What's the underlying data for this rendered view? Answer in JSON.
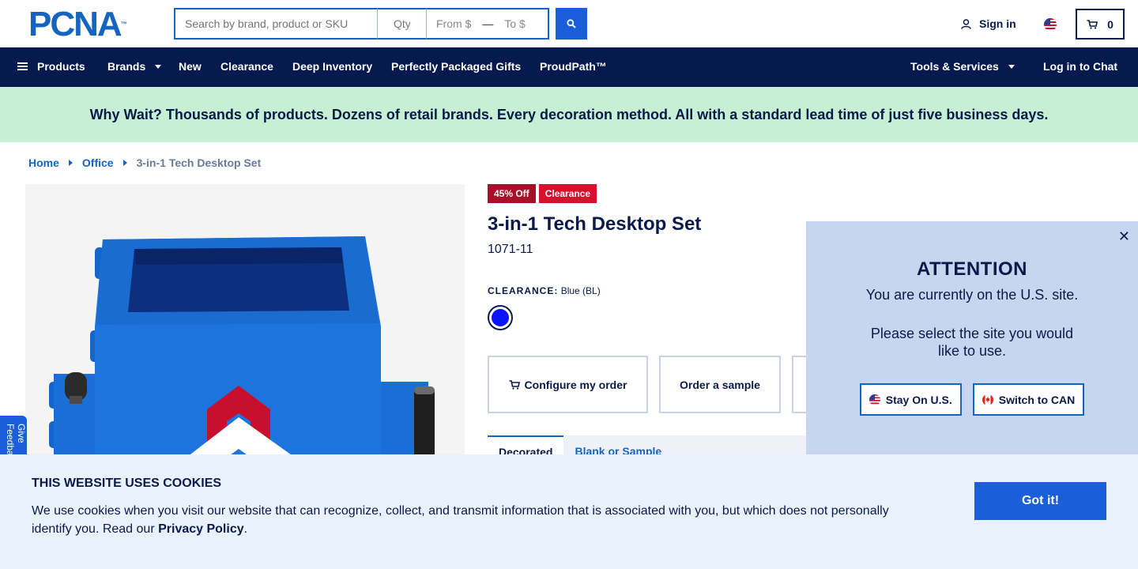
{
  "header": {
    "logo_text": "PCNA",
    "logo_mark": "™",
    "search_placeholder": "Search by brand, product or SKU",
    "qty_placeholder": "Qty",
    "price_from": "From $",
    "price_dash": "—",
    "price_to": "To $",
    "sign_in": "Sign in",
    "cart_count": "0"
  },
  "nav": {
    "products": "Products",
    "brands": "Brands",
    "new": "New",
    "clearance": "Clearance",
    "deep_inventory": "Deep Inventory",
    "gifts": "Perfectly Packaged Gifts",
    "proudpath": "ProudPath™",
    "tools": "Tools & Services",
    "chat": "Log in to Chat"
  },
  "promo": "Why Wait? Thousands of products. Dozens of retail brands. Every decoration method. All with a standard lead time of just five business days.",
  "breadcrumb": {
    "home": "Home",
    "category": "Office",
    "current": "3-in-1 Tech Desktop Set"
  },
  "product": {
    "badge_discount": "45% Off",
    "badge_clearance": "Clearance",
    "title": "3-in-1 Tech Desktop Set",
    "sku": "1071-11",
    "color_key": "CLEARANCE:",
    "color_value": "Blue (BL)",
    "swatch_color": "#0a14ff",
    "configure": "Configure my order",
    "sample": "Order a sample",
    "tab_active": "Decorated",
    "tab_inactive": "Blank or Sample"
  },
  "attention": {
    "title": "ATTENTION",
    "message1": "You are currently on the U.S. site.",
    "message2": "Please select the site you would like to use.",
    "stay_us": "Stay On U.S.",
    "switch_can": "Switch to CAN",
    "close": "✕"
  },
  "feedback": "Give Feedback",
  "cookie": {
    "title": "THIS WEBSITE USES COOKIES",
    "text": "We use cookies when you visit our website that can recognize, collect, and transmit information that is associated with you, but which does not personally identify you. Read our ",
    "link": "Privacy Policy",
    "period": ".",
    "button": "Got it!"
  },
  "colors": {
    "brand_blue": "#1565c0",
    "nav_navy": "#061a4f",
    "promo_green": "#c6efd4",
    "clearance_red": "#d3122e"
  }
}
